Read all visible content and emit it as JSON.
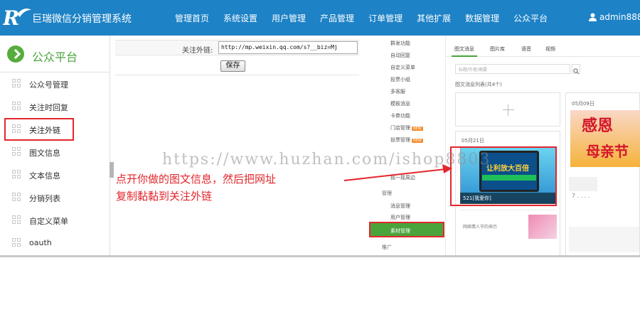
{
  "app": {
    "title": "巨瑞微信分销管理系统"
  },
  "nav": {
    "items": [
      "管理首页",
      "系统设置",
      "用户管理",
      "产品管理",
      "订单管理",
      "其他扩展",
      "数据管理",
      "公众平台"
    ]
  },
  "user": {
    "name": "admin888"
  },
  "sidebar": {
    "title": "公众平台",
    "items": [
      {
        "label": "公众号管理"
      },
      {
        "label": "关注时回复"
      },
      {
        "label": "关注外链"
      },
      {
        "label": "图文信息"
      },
      {
        "label": "文本信息"
      },
      {
        "label": "分销列表"
      },
      {
        "label": "自定义菜单"
      },
      {
        "label": "oauth"
      }
    ]
  },
  "form": {
    "field_label": "关注外链:",
    "url_value": "http://mp.weixin.qq.com/s?__biz=Mj",
    "save_label": "保存"
  },
  "wechat": {
    "menu": {
      "items": [
        {
          "label": "群发功能"
        },
        {
          "label": "自动回复"
        },
        {
          "label": "自定义菜单"
        },
        {
          "label": "投票小组"
        },
        {
          "label": "多客服"
        },
        {
          "label": "模板消息"
        },
        {
          "label": "卡券功能"
        },
        {
          "label": "门店管理",
          "badge": "NEW"
        },
        {
          "label": "投票管理",
          "badge": "NEW"
        },
        {
          "label": "摇一摇周边"
        }
      ],
      "group_manage": "管理",
      "manage_items": [
        "消息管理",
        "用户管理"
      ],
      "active_item": "素材管理",
      "promo": "推广"
    },
    "tabs": [
      "图文消息",
      "图片库",
      "语音",
      "视频"
    ],
    "search_placeholder": "标题/作者/摘要",
    "list_label": "图文消息列表(共4个)",
    "card1": {
      "date": "05月21日",
      "promo_text": "让利放大百倍",
      "caption": "521[我爱你]",
      "sub_title": "网络情人节的来历"
    },
    "card2": {
      "date": "05月09日",
      "big_text": "感恩",
      "big_text2": "母亲节",
      "dots": "7 . . . ."
    }
  },
  "overlay": {
    "watermark": "https://www.huzhan.com/ishop8803",
    "note_line1": "点开你做的图文信息，然后把网址",
    "note_line2": "复制黏黏到关注外链"
  },
  "colors": {
    "topbar": "#1d82c6",
    "accent_green": "#4aa33b",
    "highlight_red": "#e3262c"
  }
}
